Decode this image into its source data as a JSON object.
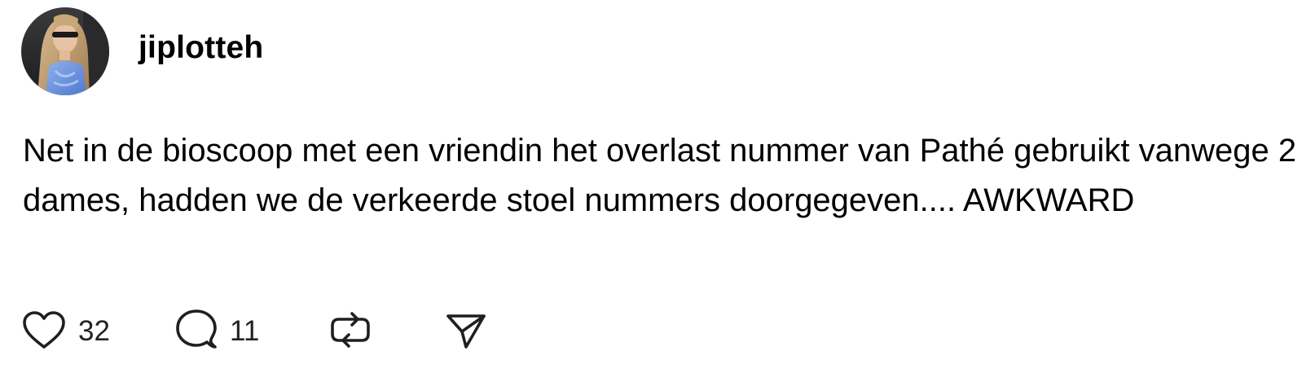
{
  "post": {
    "author": {
      "username": "jiplotteh",
      "avatar_icon": "profile-photo"
    },
    "text": "Net in de bioscoop met een vriendin het overlast nummer van Pathé gebruikt vanwege 2 dames, hadden we de verkeerde stoel nummers doorgegeven.... AWKWARD",
    "actions": {
      "like": {
        "icon": "heart-icon",
        "count": "32"
      },
      "reply": {
        "icon": "speech-bubble-icon",
        "count": "11"
      },
      "repost": {
        "icon": "repost-icon"
      },
      "share": {
        "icon": "paper-plane-icon"
      }
    },
    "colors": {
      "text": "#000000",
      "icon": "#1f1f1f",
      "background": "#ffffff"
    }
  }
}
